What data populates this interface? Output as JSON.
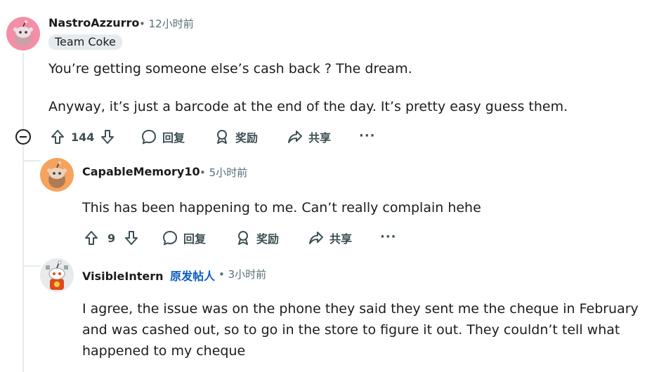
{
  "comments": [
    {
      "author": "NastroAzzurro",
      "separator": "•",
      "time": "12小时前",
      "flair": "Team Coke",
      "paragraphs": [
        "You’re getting someone else’s cash back ? The dream.",
        "Anyway, it’s just a barcode at the end of the day. It’s pretty easy guess them."
      ],
      "votes": "144",
      "reply_label": "回复",
      "award_label": "奖励",
      "share_label": "共享",
      "more_label": "···"
    },
    {
      "author": "CapableMemory10",
      "separator": "•",
      "time": "5小时前",
      "paragraphs": [
        "This has been happening to me. Can’t really complain hehe"
      ],
      "votes": "9",
      "reply_label": "回复",
      "award_label": "奖励",
      "share_label": "共享",
      "more_label": "···"
    },
    {
      "author": "VisibleIntern",
      "op_badge": "原发帖人",
      "separator": "•",
      "time": "3小时前",
      "paragraphs": [
        "I agree, the issue was on the phone they said they sent me the cheque in February and was cashed out, so to go in the store to figure it out. They couldn’t tell what happened to my cheque"
      ]
    }
  ],
  "colors": {
    "avatar_1": "#f38ea6",
    "avatar_2": "#f5a35e",
    "op_badge": "#0a5dc2",
    "meta": "#576f76",
    "thread_line": "#e5ebee"
  }
}
